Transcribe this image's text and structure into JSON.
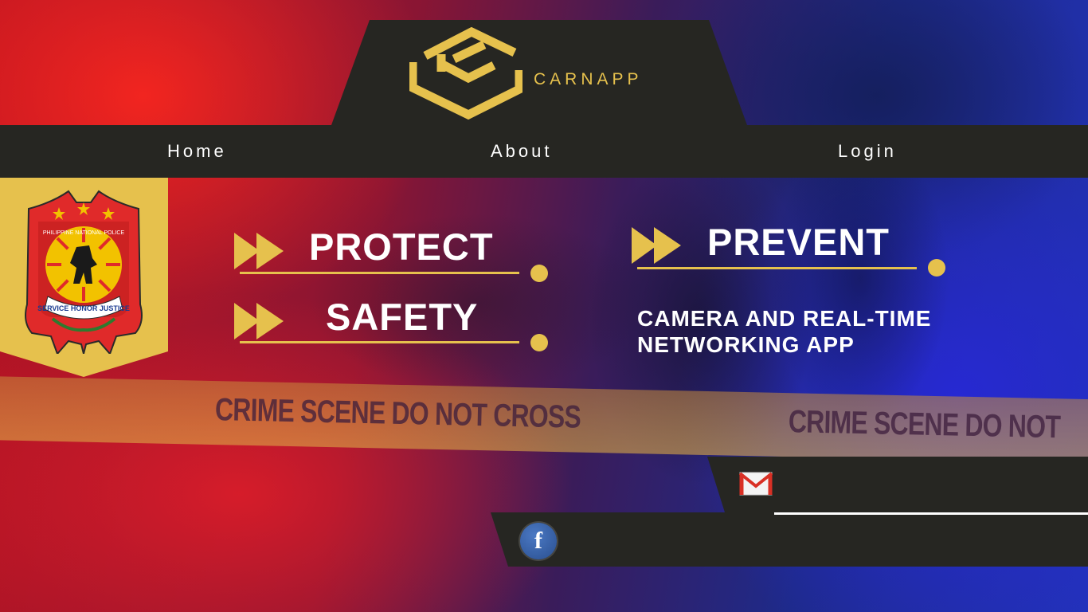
{
  "brand": {
    "name": "CARNAPP",
    "accent_color": "#e6c14d",
    "panel_color": "#262622"
  },
  "nav": {
    "home": "Home",
    "about": "About",
    "login": "Login"
  },
  "badge": {
    "org": "PHILIPPINE NATIONAL POLICE",
    "motto": "SERVICE HONOR JUSTICE"
  },
  "slogans": {
    "protect": "PROTECT",
    "safety": "SAFETY",
    "prevent": "PREVENT"
  },
  "tagline": "CAMERA AND REAL-TIME NETWORKING APP",
  "background": {
    "tape_text": "CRIME SCENE DO NOT CROSS",
    "tape_text_right": "CRIME SCENE DO NOT"
  },
  "contact": {
    "email_icon": "gmail-icon",
    "facebook_icon": "facebook-icon",
    "facebook_glyph": "f"
  }
}
